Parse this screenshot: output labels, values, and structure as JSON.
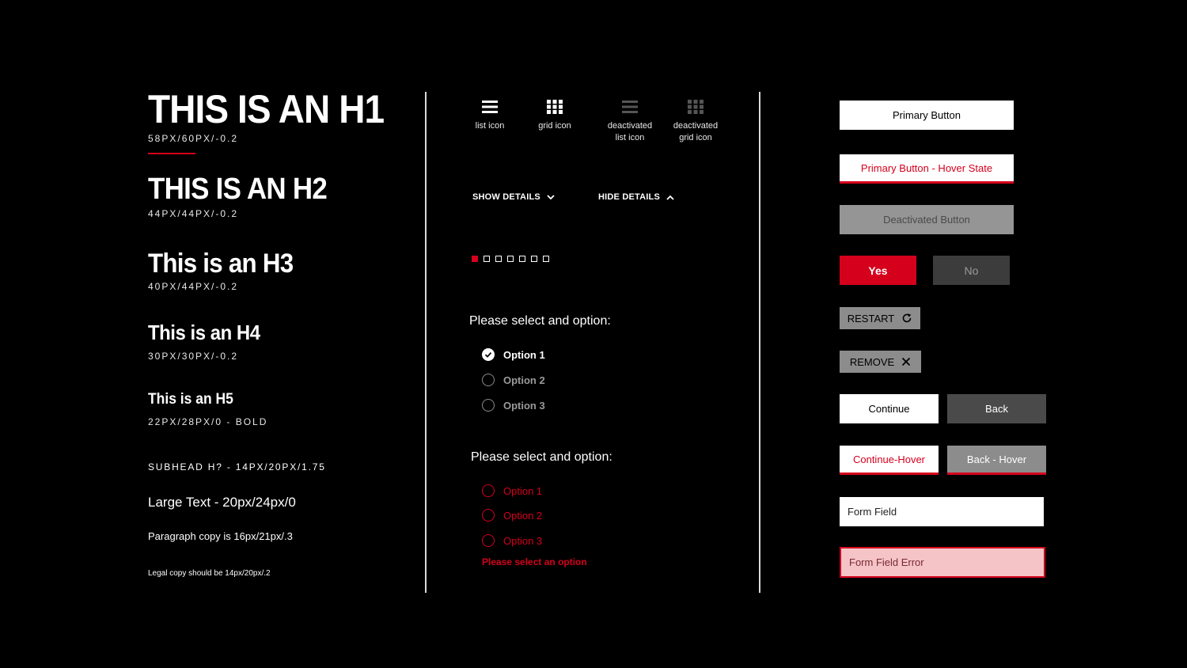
{
  "typography": {
    "h1": "THIS IS AN H1",
    "h1_spec": "58PX/60PX/-0.2",
    "h2": "THIS IS AN H2",
    "h2_spec": "44PX/44PX/-0.2",
    "h3": "This is an H3",
    "h3_spec": "40PX/44PX/-0.2",
    "h4": "This is an H4",
    "h4_spec": "30PX/30PX/-0.2",
    "h5": "This is an H5",
    "h5_spec": "22PX/28PX/0 - BOLD",
    "subhead": "SUBHEAD H? - 14PX/20PX/1.75",
    "large_text": "Large Text - 20px/24px/0",
    "paragraph": "Paragraph copy is 16px/21px/.3",
    "legal": "Legal copy should be 14px/20px/.2"
  },
  "icons": [
    {
      "name": "list-icon",
      "line1": "list icon",
      "line2": ""
    },
    {
      "name": "grid-icon",
      "line1": "grid icon",
      "line2": ""
    },
    {
      "name": "deactivated-list-icon",
      "line1": "deactivated",
      "line2": "list icon"
    },
    {
      "name": "deactivated-grid-icon",
      "line1": "deactivated",
      "line2": "grid icon"
    }
  ],
  "details": {
    "show": "SHOW DETAILS",
    "hide": "HIDE DETAILS"
  },
  "pagination": {
    "total": 7,
    "active": 1
  },
  "radio_group_1": {
    "question": "Please select and option:",
    "options": [
      "Option 1",
      "Option 2",
      "Option 3"
    ],
    "selected": "Option 1"
  },
  "radio_group_2": {
    "question": "Please select and option:",
    "options": [
      "Option 1",
      "Option 2",
      "Option 3"
    ],
    "error": "Please select an option"
  },
  "buttons": {
    "primary": "Primary Button",
    "primary_hover": "Primary Button - Hover State",
    "deactivated": "Deactivated Button",
    "yes": "Yes",
    "no": "No",
    "restart": "RESTART",
    "remove": "REMOVE",
    "continue": "Continue",
    "back": "Back",
    "continue_hover": "Continue-Hover",
    "back_hover": "Back - Hover"
  },
  "fields": {
    "normal": "Form Field",
    "error": "Form Field Error"
  },
  "colors": {
    "accent_red": "#d5001c",
    "background": "#000000",
    "grey": "#8c8c8c",
    "dark_grey": "#4a4a4a"
  }
}
